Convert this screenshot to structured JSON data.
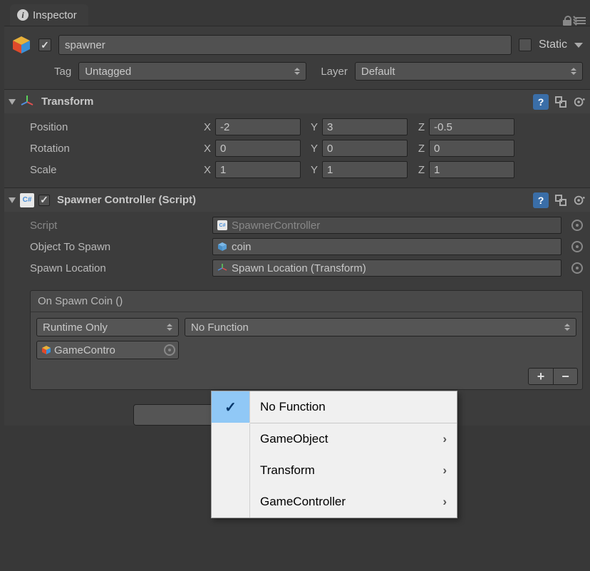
{
  "tab": {
    "title": "Inspector"
  },
  "header": {
    "name": "spawner",
    "active": true,
    "static_label": "Static",
    "static": false
  },
  "tag_row": {
    "tag_label": "Tag",
    "tag_value": "Untagged",
    "layer_label": "Layer",
    "layer_value": "Default"
  },
  "transform": {
    "title": "Transform",
    "position_label": "Position",
    "rotation_label": "Rotation",
    "scale_label": "Scale",
    "x_label": "X",
    "y_label": "Y",
    "z_label": "Z",
    "position": {
      "x": "-2",
      "y": "3",
      "z": "-0.5"
    },
    "rotation": {
      "x": "0",
      "y": "0",
      "z": "0"
    },
    "scale": {
      "x": "1",
      "y": "1",
      "z": "1"
    }
  },
  "spawner": {
    "title": "Spawner Controller (Script)",
    "enabled": true,
    "script_label": "Script",
    "script_value": "SpawnerController",
    "object_label": "Object To Spawn",
    "object_value": "coin",
    "location_label": "Spawn Location",
    "location_value": "Spawn Location (Transform)"
  },
  "event": {
    "title": "On Spawn Coin ()",
    "call_state": "Runtime Only",
    "target": "GameContro",
    "function": "No Function",
    "plus": "+",
    "minus": "−"
  },
  "context_menu": {
    "items": [
      {
        "label": "No Function",
        "selected": true,
        "submenu": false
      },
      {
        "label": "GameObject",
        "selected": false,
        "submenu": true
      },
      {
        "label": "Transform",
        "selected": false,
        "submenu": true
      },
      {
        "label": "GameController",
        "selected": false,
        "submenu": true
      }
    ]
  }
}
